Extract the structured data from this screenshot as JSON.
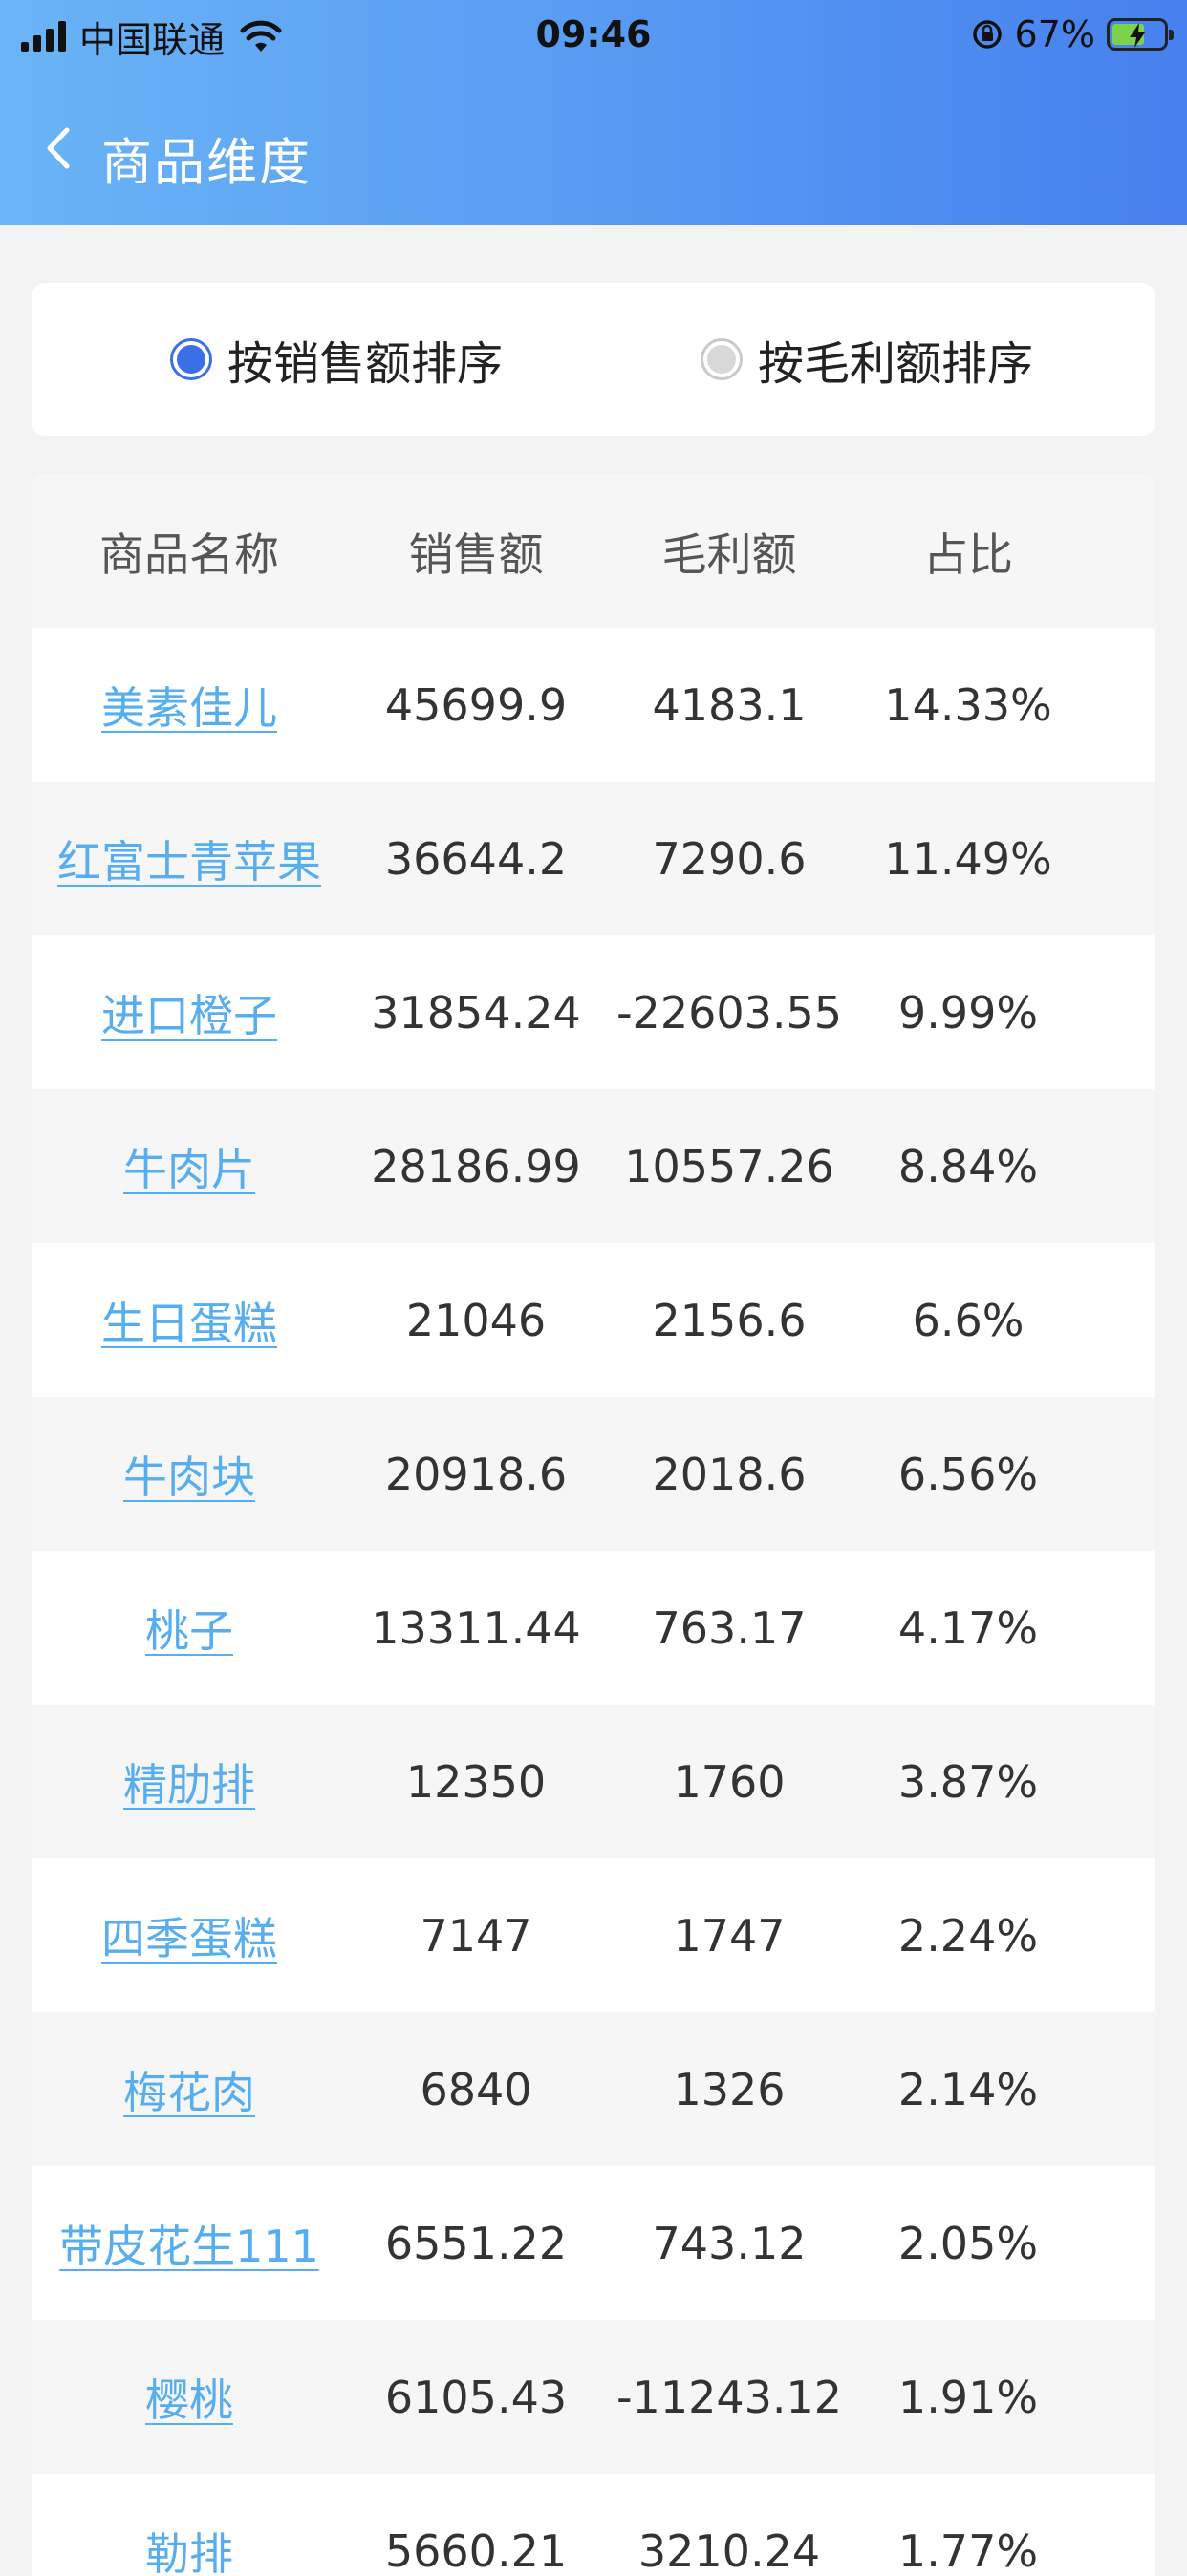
{
  "status_bar": {
    "carrier": "中国联通",
    "time": "09:46",
    "battery_percent": "67%",
    "battery_level": 0.67
  },
  "nav": {
    "title": "商品维度"
  },
  "sort_options": [
    {
      "label": "按销售额排序",
      "selected": true
    },
    {
      "label": "按毛利额排序",
      "selected": false
    }
  ],
  "table": {
    "headers": [
      "商品名称",
      "销售额",
      "毛利额",
      "占比"
    ],
    "rows": [
      {
        "name": "美素佳儿",
        "sales": "45699.9",
        "profit": "4183.1",
        "ratio": "14.33%"
      },
      {
        "name": "红富士青苹果",
        "sales": "36644.2",
        "profit": "7290.6",
        "ratio": "11.49%"
      },
      {
        "name": "进口橙子",
        "sales": "31854.24",
        "profit": "-22603.55",
        "ratio": "9.99%"
      },
      {
        "name": "牛肉片",
        "sales": "28186.99",
        "profit": "10557.26",
        "ratio": "8.84%"
      },
      {
        "name": "生日蛋糕",
        "sales": "21046",
        "profit": "2156.6",
        "ratio": "6.6%"
      },
      {
        "name": "牛肉块",
        "sales": "20918.6",
        "profit": "2018.6",
        "ratio": "6.56%"
      },
      {
        "name": "桃子",
        "sales": "13311.44",
        "profit": "763.17",
        "ratio": "4.17%"
      },
      {
        "name": "精肋排",
        "sales": "12350",
        "profit": "1760",
        "ratio": "3.87%"
      },
      {
        "name": "四季蛋糕",
        "sales": "7147",
        "profit": "1747",
        "ratio": "2.24%"
      },
      {
        "name": "梅花肉",
        "sales": "6840",
        "profit": "1326",
        "ratio": "2.14%"
      },
      {
        "name": "带皮花生111",
        "sales": "6551.22",
        "profit": "743.12",
        "ratio": "2.05%"
      },
      {
        "name": "樱桃",
        "sales": "6105.43",
        "profit": "-11243.12",
        "ratio": "1.91%"
      },
      {
        "name": "勒排",
        "sales": "5660.21",
        "profit": "3210.24",
        "ratio": "1.77%"
      }
    ]
  },
  "colors": {
    "accent": "#3b6fe6",
    "link": "#56aef0",
    "header_gradient_start": "#6ab4f6",
    "header_gradient_end": "#4680ef"
  }
}
